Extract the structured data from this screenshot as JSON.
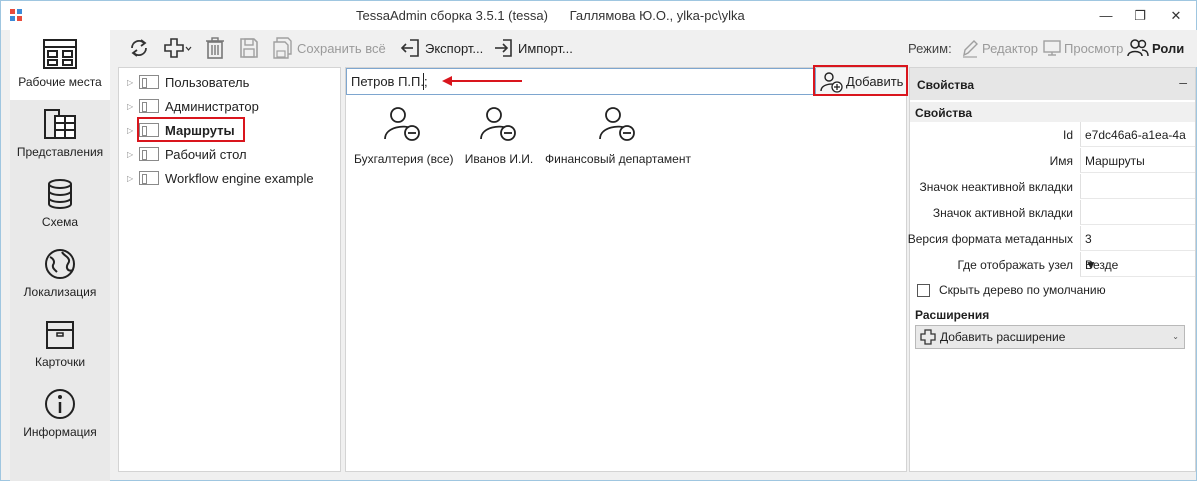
{
  "window": {
    "title": "TessaAdmin сборка 3.5.1 (tessa)      Галлямова Ю.О., ylka-pc\\ylka",
    "minimize_glyph": "—",
    "restore_glyph": "❐",
    "close_glyph": "✕"
  },
  "leftnav": {
    "items": [
      {
        "label": "Рабочие места",
        "icon": "workplaces-icon",
        "active": true
      },
      {
        "label": "Представления",
        "icon": "views-icon"
      },
      {
        "label": "Схема",
        "icon": "database-icon"
      },
      {
        "label": "Локализация",
        "icon": "globe-icon"
      },
      {
        "label": "Карточки",
        "icon": "box-icon"
      },
      {
        "label": "Информация",
        "icon": "info-icon"
      }
    ]
  },
  "toolbar": {
    "save_all": "Сохранить всё",
    "export": "Экспорт...",
    "import": "Импорт...",
    "mode_label": "Режим:",
    "editor": "Редактор",
    "preview": "Просмотр",
    "roles": "Роли"
  },
  "tree": {
    "items": [
      {
        "label": "Пользователь"
      },
      {
        "label": "Администратор"
      },
      {
        "label": "Маршруты",
        "selected": true
      },
      {
        "label": "Рабочий стол"
      },
      {
        "label": "Workflow engine example"
      }
    ]
  },
  "center": {
    "role_input_value": "Петров П.П.;",
    "add_button": "Добавить",
    "roles": [
      {
        "label": "Бухгалтерия (все)",
        "icon": "user-remove-icon"
      },
      {
        "label": "Иванов И.И.",
        "icon": "user-remove-icon"
      },
      {
        "label": "Финансовый департамент",
        "icon": "user-remove-icon"
      }
    ]
  },
  "properties": {
    "header": "Свойства",
    "collapse_glyph": "–",
    "section_props": "Свойства",
    "rows": [
      {
        "key": "Id",
        "value": "e7dc46a6-a1ea-4a"
      },
      {
        "key": "Имя",
        "value": "Маршруты"
      },
      {
        "key": "Значок неактивной вкладки",
        "value": ""
      },
      {
        "key": "Значок активной вкладки",
        "value": ""
      },
      {
        "key": "Версия формата метаданных",
        "value": "3"
      },
      {
        "key": "Где отображать узел",
        "value": "Везде"
      }
    ],
    "hide_tree_label": "Скрыть дерево по умолчанию",
    "section_ext": "Расширения",
    "add_extension": "Добавить расширение"
  },
  "colors": {
    "highlight": "#d9151d",
    "input_border": "#7ea6cf"
  }
}
